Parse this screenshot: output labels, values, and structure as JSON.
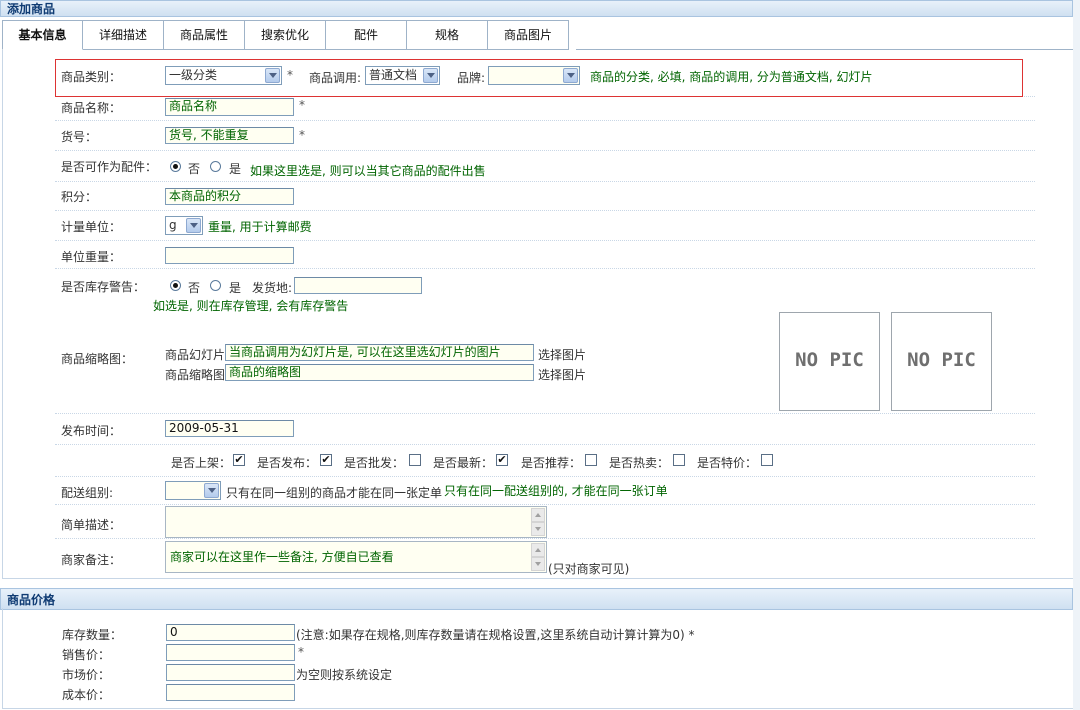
{
  "section1": {
    "title": "添加商品"
  },
  "tabs": [
    "基本信息",
    "详细描述",
    "商品属性",
    "搜索优化",
    "配件",
    "规格",
    "商品图片"
  ],
  "category": {
    "label": "商品类别：",
    "value": "一级分类",
    "required": "*"
  },
  "call": {
    "label": "商品调用:",
    "value": "普通文档"
  },
  "brand": {
    "label": "品牌:",
    "value": "",
    "hint": "商品的分类, 必填, 商品的调用, 分为普通文档, 幻灯片"
  },
  "name": {
    "label": "商品名称：",
    "value": "商品名称",
    "required": "*"
  },
  "sku": {
    "label": "货号：",
    "value": "货号, 不能重复",
    "required": "*"
  },
  "accessory": {
    "label": "是否可作为配件：",
    "no": "否",
    "yes": "是",
    "hint": "如果这里选是, 则可以当其它商品的配件出售"
  },
  "points": {
    "label": "积分：",
    "value": "本商品的积分"
  },
  "unit": {
    "label": "计量单位：",
    "value": "g",
    "hint": "重量, 用于计算邮费"
  },
  "weight": {
    "label": "单位重量：",
    "value": ""
  },
  "stock_warn": {
    "label": "是否库存警告：",
    "no": "否",
    "yes": "是",
    "ship_label": "发货地:",
    "ship_value": "",
    "hint": "如选是, 则在库存管理, 会有库存警告"
  },
  "thumb": {
    "label": "商品缩略图：",
    "slide_label": "商品幻灯片",
    "slide_value": "当商品调用为幻灯片是, 可以在这里选幻灯片的图片",
    "slide_btn": "选择图片",
    "thumb_label": "商品缩略图",
    "thumb_value": "商品的缩略图",
    "thumb_btn": "选择图片",
    "nopic1": "NO PIC",
    "nopic2": "NO PIC"
  },
  "publish": {
    "label": "发布时间：",
    "value": "2009-05-31"
  },
  "flags": [
    {
      "label": "是否上架：",
      "checked": true
    },
    {
      "label": "是否发布：",
      "checked": true
    },
    {
      "label": "是否批发：",
      "checked": false
    },
    {
      "label": "是否最新：",
      "checked": true
    },
    {
      "label": "是否推荐：",
      "checked": false
    },
    {
      "label": "是否热卖：",
      "checked": false
    },
    {
      "label": "是否特价：",
      "checked": false
    }
  ],
  "delivery": {
    "label": "配送组别:",
    "value": "",
    "note": "只有在同一组别的商品才能在同一张定单",
    "hint": "只有在同一配送组别的, 才能在同一张订单"
  },
  "brief": {
    "label": "简单描述：",
    "value": ""
  },
  "memo": {
    "label": "商家备注：",
    "value": "商家可以在这里作一些备注, 方便自已查看",
    "note": "(只对商家可见)"
  },
  "section2": {
    "title": "商品价格"
  },
  "price": {
    "stock_label": "库存数量：",
    "stock_value": "0",
    "stock_note": "(注意:如果存在规格,则库存数量请在规格设置,这里系统自动计算计算为0) *",
    "sale_label": "销售价：",
    "sale_value": "",
    "sale_req": "*",
    "market_label": "市场价：",
    "market_value": "",
    "market_note": "为空则按系统设定",
    "cost_label": "成本价：",
    "cost_value": ""
  }
}
